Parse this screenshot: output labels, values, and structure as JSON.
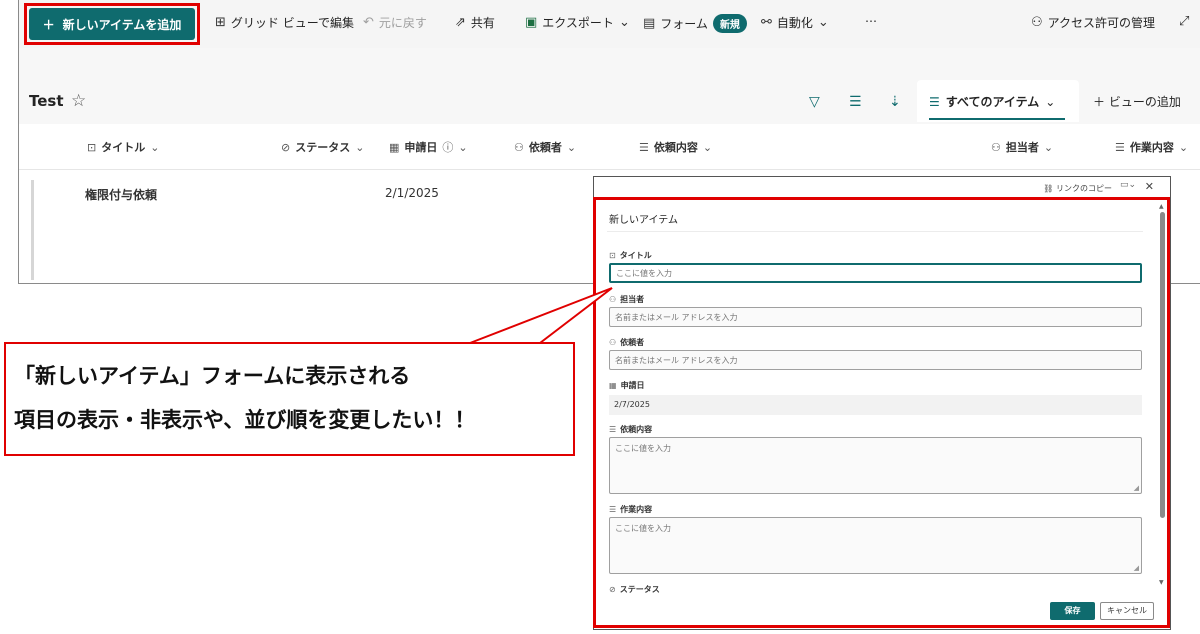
{
  "commandbar": {
    "new_item": "新しいアイテムを追加",
    "grid_edit": "グリッド ビューで編集",
    "undo": "元に戻す",
    "share": "共有",
    "export": "エクスポート",
    "forms": "フォーム",
    "forms_badge": "新規",
    "automate": "自動化",
    "more": "⋯",
    "manage_access": "アクセス許可の管理"
  },
  "list": {
    "title": "Test",
    "view_name": "すべてのアイテム",
    "add_view": "ビューの追加",
    "columns": [
      {
        "label": "タイトル",
        "icon": "text-field-icon"
      },
      {
        "label": "ステータス",
        "icon": "check-circle-icon"
      },
      {
        "label": "申請日",
        "icon": "calendar-icon"
      },
      {
        "label": "依頼者",
        "icon": "person-icon"
      },
      {
        "label": "依頼内容",
        "icon": "multiline-text-icon"
      },
      {
        "label": "担当者",
        "icon": "person-icon"
      },
      {
        "label": "作業内容",
        "icon": "multiline-text-icon"
      }
    ],
    "rows": [
      {
        "title": "権限付与依頼",
        "date": "2/1/2025"
      }
    ]
  },
  "form": {
    "copy_link": "リンクのコピー",
    "title": "新しいアイテム",
    "fields": [
      {
        "label": "タイトル",
        "placeholder": "ここに値を入力"
      },
      {
        "label": "担当者",
        "placeholder": "名前またはメール アドレスを入力"
      },
      {
        "label": "依頼者",
        "placeholder": "名前またはメール アドレスを入力"
      },
      {
        "label": "申請日",
        "value": "2/7/2025"
      },
      {
        "label": "依頼内容",
        "placeholder": "ここに値を入力"
      },
      {
        "label": "作業内容",
        "placeholder": "ここに値を入力"
      },
      {
        "label": "ステータス"
      }
    ],
    "save": "保存",
    "cancel": "キャンセル"
  },
  "callout": {
    "line1": "「新しいアイテム」フォームに表示される",
    "line2": "項目の表示・非表示や、並び順を変更したい！！"
  },
  "colors": {
    "accent": "#0f6b6e",
    "highlight": "#e00000"
  }
}
